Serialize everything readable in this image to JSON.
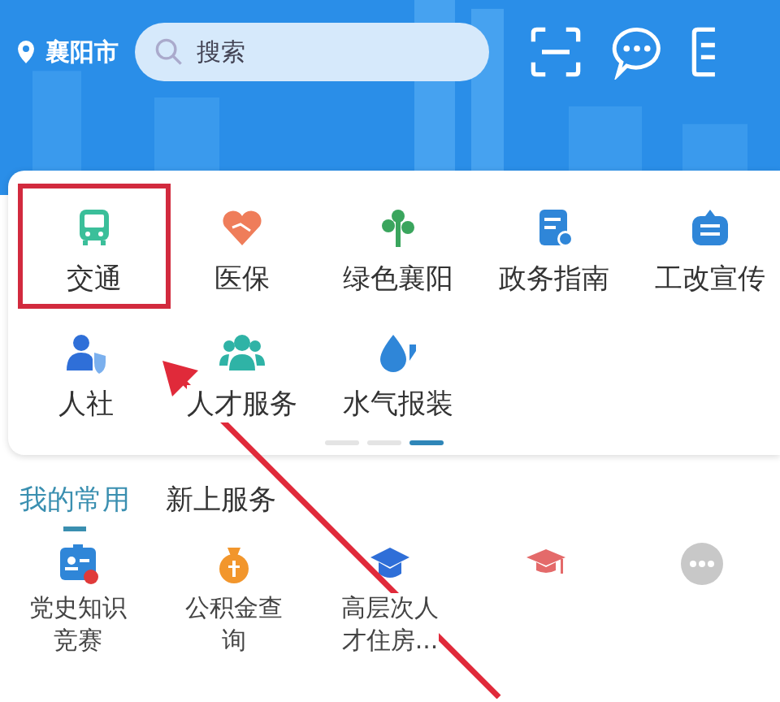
{
  "header": {
    "city": "襄阳市",
    "search": {
      "placeholder": "搜索"
    }
  },
  "services": [
    {
      "label": "交通",
      "highlighted": true
    },
    {
      "label": "医保",
      "highlighted": false
    },
    {
      "label": "绿色襄阳",
      "highlighted": false
    },
    {
      "label": "政务指南",
      "highlighted": false
    },
    {
      "label": "工改宣传",
      "highlighted": false
    },
    {
      "label": "人社",
      "highlighted": false
    },
    {
      "label": "人才服务",
      "highlighted": false
    },
    {
      "label": "水气报装",
      "highlighted": false
    }
  ],
  "pager": [
    {
      "selected": false
    },
    {
      "selected": false
    },
    {
      "selected": true
    }
  ],
  "tabs": [
    {
      "label": "我的常用",
      "selected": true
    },
    {
      "label": "新上服务",
      "selected": false
    }
  ],
  "favorites": [
    {
      "kind": "labeled",
      "label": "党史知识竞赛"
    },
    {
      "kind": "labeled",
      "label": "公积金查询"
    },
    {
      "kind": "labeled",
      "label": "高层次人才住房..."
    },
    {
      "kind": "icon-only"
    },
    {
      "kind": "icon-only"
    }
  ]
}
